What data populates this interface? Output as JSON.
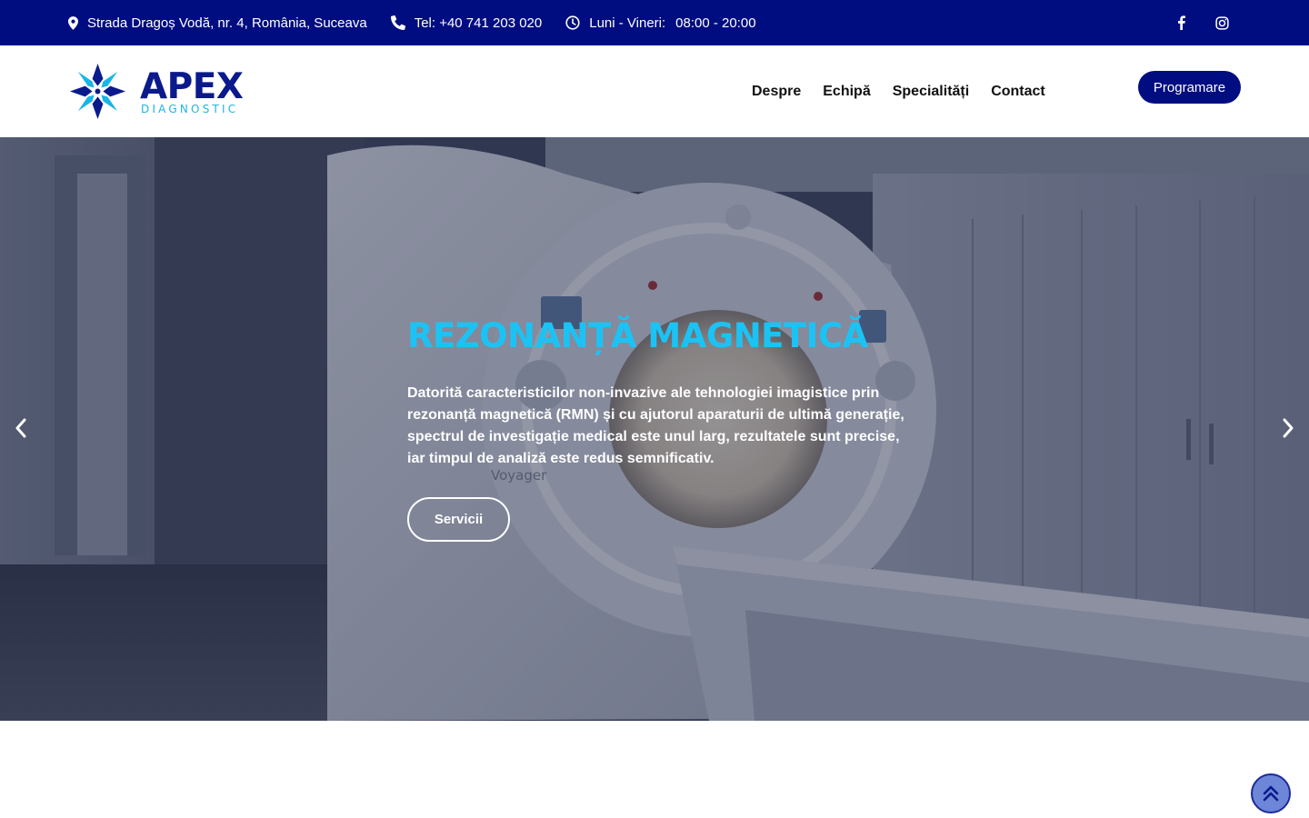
{
  "topbar": {
    "address": "Strada Dragoș Vodă, nr. 4, România, Suceava",
    "phone": "Tel: +40 741 203 020",
    "hours_label": "Luni - Vineri:",
    "hours_value": "08:00 - 20:00",
    "icons": [
      "map-marker-icon",
      "phone-icon",
      "clock-icon",
      "facebook-icon",
      "instagram-icon"
    ]
  },
  "header": {
    "logo_name": "APEX",
    "logo_sub": "DIAGNOSTIC",
    "nav": [
      "Despre",
      "Echipă",
      "Specialități",
      "Contact"
    ],
    "cta": "Programare"
  },
  "hero": {
    "title": "REZONANȚĂ MAGNETICĂ",
    "text": "Datorită caracteristicilor non-invazive ale tehnologiei imagistice prin rezonanță magnetică (RMN) și cu ajutorul aparaturii de ultimă generație, spectrul de investigație medical este unul larg, rezultatele sunt precise, iar timpul de analiză este redus semnificativ.",
    "button": "Servicii",
    "machine_label": "Voyager"
  },
  "colors": {
    "brand_navy": "#000d80",
    "accent_cyan": "#1bc3f5",
    "scroll_button": "#6d86d8"
  }
}
